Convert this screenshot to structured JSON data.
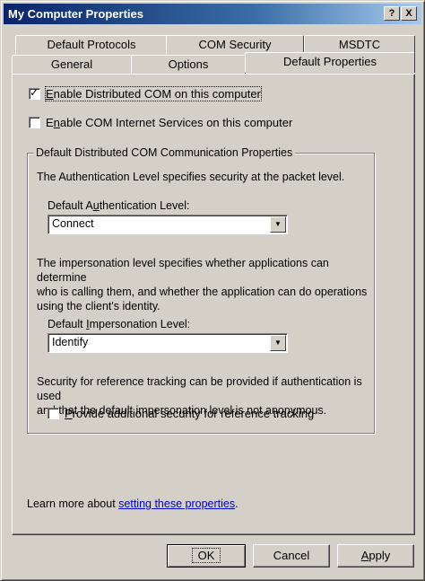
{
  "window": {
    "title": "My Computer Properties",
    "help_button": "?",
    "close_button": "X"
  },
  "tabs": {
    "row_back": [
      "Default Protocols",
      "COM Security",
      "MSDTC"
    ],
    "row_front": [
      "General",
      "Options",
      "Default Properties"
    ],
    "active": "Default Properties"
  },
  "options": {
    "enable_dcom": {
      "pre": "",
      "key": "E",
      "post": "nable Distributed COM on this computer",
      "checked": true
    },
    "enable_cis": {
      "pre": "E",
      "key": "n",
      "post": "able COM Internet Services on this computer",
      "checked": false
    }
  },
  "group": {
    "legend": "Default Distributed COM Communication Properties",
    "auth_desc": "The Authentication Level specifies security at the packet level.",
    "auth_label": {
      "pre": "Default A",
      "key": "u",
      "post": "thentication Level:"
    },
    "auth_value": "Connect",
    "imp_desc": [
      "The impersonation level specifies whether applications can determine",
      "who is calling them, and whether the application can do operations",
      "using the client's identity."
    ],
    "imp_label": {
      "pre": "Default ",
      "key": "I",
      "post": "mpersonation Level:"
    },
    "imp_value": "Identify",
    "ref_desc": [
      "Security for reference tracking can be provided if authentication is used",
      "and that the default impersonation level is not anonymous."
    ],
    "ref_check": {
      "pre": "",
      "key": "P",
      "post": "rovide additional security for reference tracking",
      "checked": false
    }
  },
  "learn_more": {
    "prefix": "Learn more about ",
    "link": "setting these properties",
    "suffix": "."
  },
  "buttons": {
    "ok": "OK",
    "cancel": "Cancel",
    "apply": {
      "key": "A",
      "post": "pply"
    }
  }
}
